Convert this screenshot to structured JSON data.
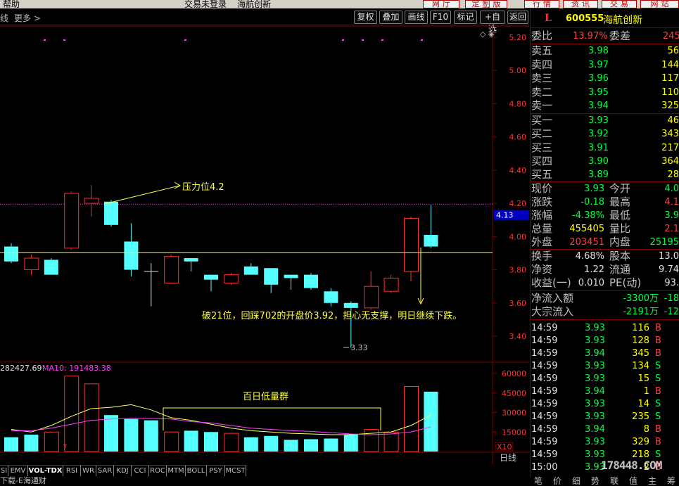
{
  "app": {
    "menu": "帮助",
    "window_title": "交易未登录    海航创新",
    "top_buttons": [
      "网厅",
      "定制版面",
      "行情",
      "资讯",
      "交易",
      "网站"
    ]
  },
  "toolbar": {
    "left_label": "线",
    "more_label": "更多 >",
    "buttons": [
      "复权",
      "叠加",
      "画线",
      "F10",
      "标记",
      "+自选",
      "返回"
    ]
  },
  "chart_data": [
    {
      "type": "candlestick",
      "ylim": [
        3.25,
        5.25
      ],
      "y_ticks": [
        "5.20",
        "5.00",
        "4.80",
        "4.60",
        "4.40",
        "4.20",
        "4.00",
        "3.80",
        "3.60",
        "3.40"
      ],
      "current_price_tag": "4.13",
      "candles": [
        {
          "o": 3.94,
          "c": 3.85,
          "h": 3.96,
          "l": 3.84
        },
        {
          "o": 3.8,
          "c": 3.87,
          "h": 3.89,
          "l": 3.77
        },
        {
          "o": 3.86,
          "c": 3.77,
          "h": 3.87,
          "l": 3.77
        },
        {
          "o": 3.93,
          "c": 4.26,
          "h": 4.27,
          "l": 3.92
        },
        {
          "o": 4.2,
          "c": 4.23,
          "h": 4.31,
          "l": 4.12
        },
        {
          "o": 4.21,
          "c": 4.07,
          "h": 4.22,
          "l": 4.06
        },
        {
          "o": 3.97,
          "c": 3.8,
          "h": 4.08,
          "l": 3.76
        },
        {
          "o": 3.79,
          "c": 3.79,
          "h": 3.84,
          "l": 3.58
        },
        {
          "o": 3.72,
          "c": 3.88,
          "h": 3.89,
          "l": 3.72
        },
        {
          "o": 3.87,
          "c": 3.85,
          "h": 3.87,
          "l": 3.79
        },
        {
          "o": 3.77,
          "c": 3.74,
          "h": 3.77,
          "l": 3.67
        },
        {
          "o": 3.72,
          "c": 3.77,
          "h": 3.78,
          "l": 3.71
        },
        {
          "o": 3.82,
          "c": 3.77,
          "h": 3.84,
          "l": 3.77
        },
        {
          "o": 3.81,
          "c": 3.71,
          "h": 3.81,
          "l": 3.66
        },
        {
          "o": 3.77,
          "c": 3.75,
          "h": 3.77,
          "l": 3.68
        },
        {
          "o": 3.77,
          "c": 3.69,
          "h": 3.78,
          "l": 3.68
        },
        {
          "o": 3.67,
          "c": 3.6,
          "h": 3.69,
          "l": 3.58
        },
        {
          "o": 3.6,
          "c": 3.57,
          "h": 3.61,
          "l": 3.33
        },
        {
          "o": 3.57,
          "c": 3.7,
          "h": 3.79,
          "l": 3.56
        },
        {
          "o": 3.67,
          "c": 3.75,
          "h": 3.77,
          "l": 3.66
        },
        {
          "o": 3.79,
          "c": 4.11,
          "h": 4.12,
          "l": 3.73
        },
        {
          "o": 4.01,
          "c": 3.94,
          "h": 4.19,
          "l": 3.93
        }
      ],
      "annotations": {
        "pressure": "压力位4.2",
        "comment": "破21位，回踩702的开盘价3.92，担心无支撑，明日继续下跌。",
        "low": "3.33"
      }
    },
    {
      "type": "bar",
      "title": "282427.69",
      "ma_label": "MA10: 191483.38",
      "ylim": [
        0,
        65000
      ],
      "y_ticks": [
        "60000",
        "45000",
        "30000",
        "15000"
      ],
      "unit": "X10",
      "box_label": "百日低量群",
      "marker": "7",
      "volumes": [
        11000,
        13000,
        15000,
        58000,
        52000,
        28000,
        25000,
        24000,
        15000,
        16000,
        15000,
        14000,
        11000,
        12000,
        9000,
        9500,
        10000,
        13000,
        17000,
        15000,
        50000,
        46000
      ],
      "up": [
        false,
        false,
        true,
        true,
        true,
        false,
        false,
        false,
        true,
        false,
        false,
        true,
        false,
        false,
        false,
        false,
        false,
        false,
        true,
        true,
        true,
        false
      ],
      "ma_white": [
        17000,
        15000,
        20000,
        27000,
        33000,
        34000,
        36000,
        32000,
        26000,
        24000,
        21000,
        18000,
        16000,
        15000,
        14000,
        13500,
        13000,
        13000,
        14000,
        15000,
        20000,
        28000
      ],
      "ma_magenta": [
        16000,
        16000,
        18000,
        21000,
        24000,
        25000,
        25500,
        25500,
        25000,
        23000,
        22000,
        20000,
        18000,
        17000,
        16000,
        15500,
        14500,
        13500,
        13000,
        13500,
        15000,
        19000
      ]
    }
  ],
  "period_label": "日线",
  "indicator_tabs": [
    "SI",
    "EMV",
    "VOL-TDX",
    "RSI",
    "WR",
    "SAR",
    "KDJ",
    "CCI",
    "ROC",
    "MTM",
    "BOLL",
    "PSY",
    "MCST"
  ],
  "status_text": "下载-E海通财",
  "quote": {
    "mark": "L",
    "code": "600555",
    "name": "海航创新",
    "weibi_label": "委比",
    "weibi": "13.97%",
    "weicha_label": "委差",
    "weicha": "245",
    "sells": [
      {
        "label": "卖五",
        "price": "3.98",
        "vol": "56"
      },
      {
        "label": "卖四",
        "price": "3.97",
        "vol": "144"
      },
      {
        "label": "卖三",
        "price": "3.96",
        "vol": "117"
      },
      {
        "label": "卖二",
        "price": "3.95",
        "vol": "110"
      },
      {
        "label": "卖一",
        "price": "3.94",
        "vol": "325"
      }
    ],
    "buys": [
      {
        "label": "买一",
        "price": "3.93",
        "vol": "46"
      },
      {
        "label": "买二",
        "price": "3.92",
        "vol": "343"
      },
      {
        "label": "买三",
        "price": "3.91",
        "vol": "217"
      },
      {
        "label": "买四",
        "price": "3.90",
        "vol": "364"
      },
      {
        "label": "买五",
        "price": "3.89",
        "vol": "28"
      }
    ],
    "stats1": [
      {
        "l1": "现价",
        "v1": "3.93",
        "c1": "grn",
        "l2": "今开",
        "v2": "4.0",
        "c2": "grn"
      },
      {
        "l1": "涨跌",
        "v1": "-0.18",
        "c1": "grn",
        "l2": "最高",
        "v2": "4.1",
        "c2": "red"
      },
      {
        "l1": "涨幅",
        "v1": "-4.38%",
        "c1": "grn",
        "l2": "最低",
        "v2": "3.9",
        "c2": "grn"
      },
      {
        "l1": "总量",
        "v1": "455405",
        "c1": "yel",
        "l2": "量比",
        "v2": "2.1",
        "c2": "red"
      },
      {
        "l1": "外盘",
        "v1": "203451",
        "c1": "red",
        "l2": "内盘",
        "v2": "25195",
        "c2": "grn"
      }
    ],
    "stats2": [
      {
        "l1": "换手",
        "v1": "4.68%",
        "c1": "wht",
        "l2": "股本",
        "v2": "13.0",
        "c2": "wht"
      },
      {
        "l1": "净资",
        "v1": "1.22",
        "c1": "wht",
        "l2": "流通",
        "v2": "9.74",
        "c2": "wht"
      },
      {
        "l1": "收益(一)",
        "v1": "0.010",
        "c1": "wht",
        "l2": "PE(动)",
        "v2": "93.",
        "c2": "wht"
      }
    ],
    "flows": [
      {
        "label": "净流入额",
        "value": "-3300万",
        "extra": "-18"
      },
      {
        "label": "大宗流入",
        "value": "-2191万",
        "extra": "-12"
      }
    ],
    "ticks": [
      {
        "t": "14:59",
        "p": "3.93",
        "v": "116",
        "s": "B"
      },
      {
        "t": "14:59",
        "p": "3.93",
        "v": "128",
        "s": "B"
      },
      {
        "t": "14:59",
        "p": "3.94",
        "v": "345",
        "s": "B"
      },
      {
        "t": "14:59",
        "p": "3.93",
        "v": "134",
        "s": "S"
      },
      {
        "t": "14:59",
        "p": "3.93",
        "v": "15",
        "s": "S"
      },
      {
        "t": "14:59",
        "p": "3.94",
        "v": "1",
        "s": "B"
      },
      {
        "t": "14:59",
        "p": "3.93",
        "v": "14",
        "s": "S"
      },
      {
        "t": "14:59",
        "p": "3.93",
        "v": "235",
        "s": "S"
      },
      {
        "t": "14:59",
        "p": "3.94",
        "v": "8",
        "s": "B"
      },
      {
        "t": "14:59",
        "p": "3.93",
        "v": "329",
        "s": "B"
      },
      {
        "t": "14:59",
        "p": "3.93",
        "v": "218",
        "s": "S"
      },
      {
        "t": "15:00",
        "p": "3.93",
        "v": "2",
        "s": "B"
      }
    ],
    "watermark": "178448.COM",
    "side_tabs": [
      "笔",
      "价",
      "细",
      "势",
      "联",
      "值",
      "主",
      "筹"
    ]
  }
}
